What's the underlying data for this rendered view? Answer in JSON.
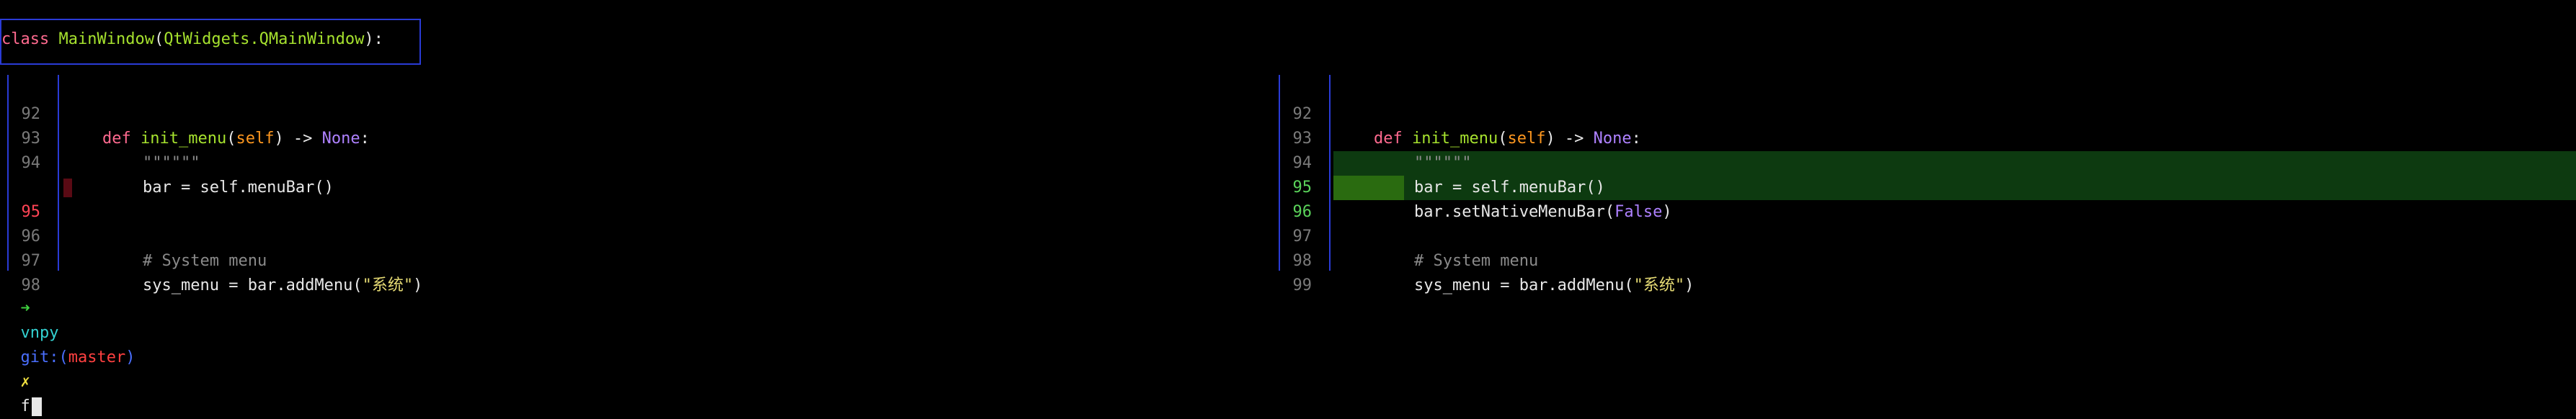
{
  "context": {
    "kw": "class ",
    "name": "MainWindow",
    "open": "(",
    "base": "QtWidgets.QMainWindow",
    "close": "):"
  },
  "left_pane": [
    {
      "ln": "92",
      "kind": "normal"
    },
    {
      "ln": "93",
      "kind": "normal"
    },
    {
      "ln": "94",
      "kind": "normal"
    },
    {
      "ln": "",
      "kind": "blank"
    },
    {
      "ln": "95",
      "kind": "deleted"
    },
    {
      "ln": "",
      "kind": "blank"
    },
    {
      "ln": "96",
      "kind": "normal"
    },
    {
      "ln": "97",
      "kind": "normal"
    },
    {
      "ln": "98",
      "kind": "normal"
    }
  ],
  "right_pane": [
    {
      "ln": "92",
      "kind": "normal"
    },
    {
      "ln": "93",
      "kind": "normal"
    },
    {
      "ln": "94",
      "kind": "normal"
    },
    {
      "ln": "95",
      "kind": "added"
    },
    {
      "ln": "96",
      "kind": "added"
    },
    {
      "ln": "97",
      "kind": "normal"
    },
    {
      "ln": "98",
      "kind": "normal"
    },
    {
      "ln": "99",
      "kind": "normal"
    }
  ],
  "code": {
    "def_kw": "def ",
    "init_menu": "init_menu",
    "paren_open": "(",
    "self": "self",
    "sig_rest": ") -> ",
    "none": "None",
    "colon": ":",
    "docstring": "\"\"\"\"\"\"",
    "menubar_line": "bar = self.menuBar()",
    "native_pre": "bar.setNativeMenuBar(",
    "false": "False",
    "native_post": ")",
    "comment": "# System menu",
    "sys_pre": "sys_menu = bar.addMenu(",
    "sys_str": "\"系统\"",
    "sys_post": ")"
  },
  "prompt": {
    "arrow": "➜",
    "dir": "vnpy",
    "git": "git:(",
    "branch": "master",
    "git_close": ")",
    "dirty": "✗",
    "input": "f"
  }
}
